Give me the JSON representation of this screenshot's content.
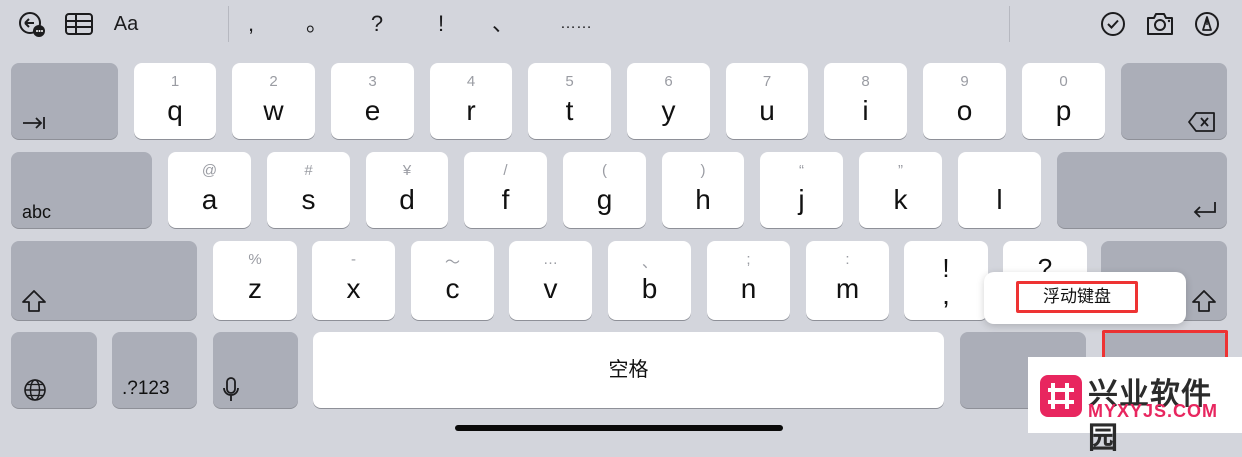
{
  "toolbar": {
    "format_label": "Aa",
    "punctuation": [
      ",",
      "。",
      "?",
      "!",
      "、",
      "……"
    ]
  },
  "keys": {
    "row1": [
      {
        "sec": "1",
        "pri": "q"
      },
      {
        "sec": "2",
        "pri": "w"
      },
      {
        "sec": "3",
        "pri": "e"
      },
      {
        "sec": "4",
        "pri": "r"
      },
      {
        "sec": "5",
        "pri": "t"
      },
      {
        "sec": "6",
        "pri": "y"
      },
      {
        "sec": "7",
        "pri": "u"
      },
      {
        "sec": "8",
        "pri": "i"
      },
      {
        "sec": "9",
        "pri": "o"
      },
      {
        "sec": "0",
        "pri": "p"
      }
    ],
    "row2": [
      {
        "sec": "@",
        "pri": "a"
      },
      {
        "sec": "#",
        "pri": "s"
      },
      {
        "sec": "¥",
        "pri": "d"
      },
      {
        "sec": "/",
        "pri": "f"
      },
      {
        "sec": "(",
        "pri": "g"
      },
      {
        "sec": ")",
        "pri": "h"
      },
      {
        "sec": "“",
        "pri": "j"
      },
      {
        "sec": "”",
        "pri": "k"
      },
      {
        "sec": "",
        "pri": "l"
      }
    ],
    "row3": [
      {
        "sec": "%",
        "pri": "z"
      },
      {
        "sec": "-",
        "pri": "x"
      },
      {
        "sec": "〜",
        "pri": "c"
      },
      {
        "sec": "…",
        "pri": "v"
      },
      {
        "sec": "、",
        "pri": "b"
      },
      {
        "sec": ";",
        "pri": "n"
      },
      {
        "sec": ":",
        "pri": "m"
      },
      {
        "sec": "!",
        "pri": ","
      },
      {
        "sec": "?",
        "pri": ""
      }
    ],
    "abc_label": "abc",
    "numbers_label": ".?123",
    "space_label": "空格"
  },
  "popup": {
    "label": "浮动键盘"
  },
  "watermark": {
    "title": "兴业软件园",
    "url": "MYXYJS.COM"
  }
}
